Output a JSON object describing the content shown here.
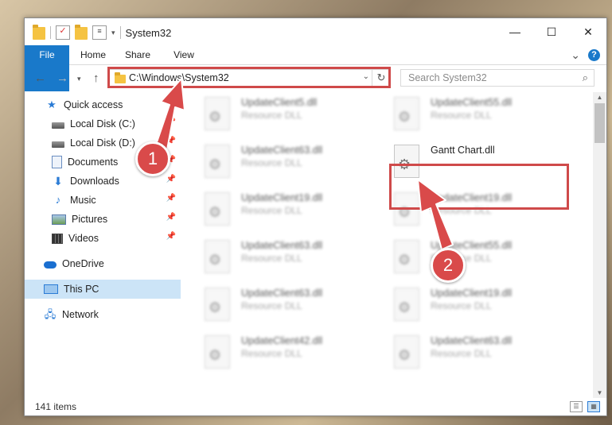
{
  "window": {
    "title": "System32",
    "controls": {
      "minimize": "—",
      "maximize": "☐",
      "close": "✕"
    }
  },
  "ribbon": {
    "tabs": [
      "File",
      "Home",
      "Share",
      "View"
    ],
    "collapse": "⌄",
    "help": "?"
  },
  "address": {
    "path": "C:\\Windows\\System32",
    "search_placeholder": "Search System32"
  },
  "nav_pane": {
    "items": [
      {
        "label": "Quick access",
        "icon": "star-icon"
      },
      {
        "label": "Local Disk (C:)",
        "icon": "drive-icon",
        "pinned": true
      },
      {
        "label": "Local Disk (D:)",
        "icon": "drive-icon",
        "pinned": true
      },
      {
        "label": "Documents",
        "icon": "documents-icon",
        "pinned": true
      },
      {
        "label": "Downloads",
        "icon": "download-icon",
        "pinned": true
      },
      {
        "label": "Music",
        "icon": "music-icon",
        "pinned": true
      },
      {
        "label": "Pictures",
        "icon": "pictures-icon",
        "pinned": true
      },
      {
        "label": "Videos",
        "icon": "videos-icon",
        "pinned": true
      },
      {
        "label": "OneDrive",
        "icon": "cloud-icon"
      },
      {
        "label": "This PC",
        "icon": "computer-icon",
        "selected": true
      },
      {
        "label": "Network",
        "icon": "network-icon"
      }
    ]
  },
  "files": {
    "left_column": [
      {
        "name": "UpdateClient5.dll",
        "type": "Resource DLL"
      },
      {
        "name": "UpdateClient63.dll",
        "type": "Resource DLL"
      },
      {
        "name": "UpdateClient19.dll",
        "type": "Resource DLL"
      },
      {
        "name": "UpdateClient63.dll",
        "type": "Resource DLL"
      },
      {
        "name": "UpdateClient63.dll",
        "type": "Resource DLL"
      },
      {
        "name": "UpdateClient42.dll",
        "type": "Resource DLL"
      }
    ],
    "right_column": [
      {
        "name": "UpdateClient55.dll",
        "type": "Resource DLL"
      },
      {
        "name": "Gantt Chart.dll",
        "type": ""
      },
      {
        "name": "UpdateClient19.dll",
        "type": "Resource DLL"
      },
      {
        "name": "UpdateClient55.dll",
        "type": "Resource DLL"
      },
      {
        "name": "UpdateClient19.dll",
        "type": "Resource DLL"
      },
      {
        "name": "UpdateClient63.dll",
        "type": "Resource DLL"
      }
    ]
  },
  "status": {
    "item_count": "141 items"
  },
  "callouts": {
    "one": "1",
    "two": "2"
  },
  "colors": {
    "accent": "#1979ca",
    "highlight": "#cf4a4a",
    "selection": "#cce4f7"
  }
}
